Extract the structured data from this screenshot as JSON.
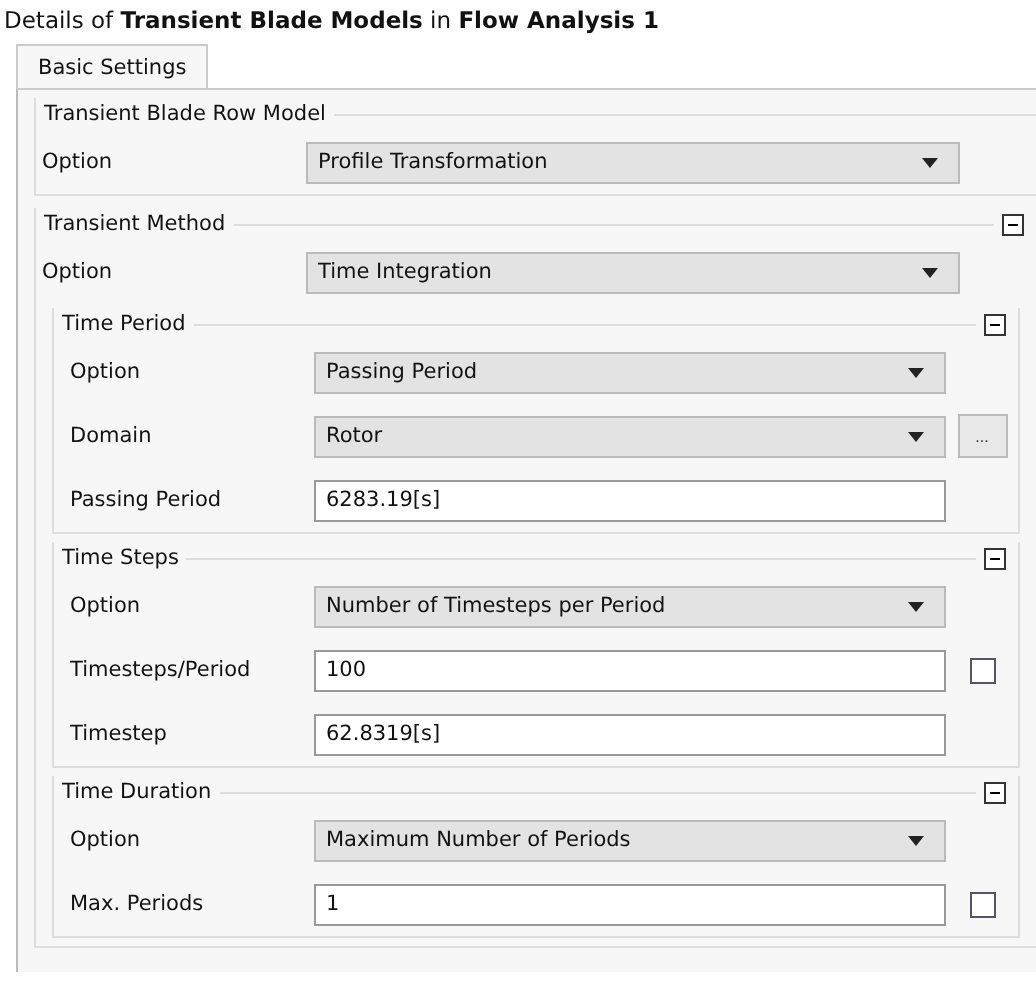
{
  "title": "Details of **Transient Blade Models** in **Flow Analysis 1**",
  "tabs": [
    {
      "label": "Basic Settings",
      "selected": true
    }
  ],
  "groups": [
    {
      "title": "Transient Blade Row Model",
      "rows": [
        {
          "kind": "dropdown",
          "label": "Option",
          "value": "Profile Transformation"
        }
      ]
    },
    {
      "title": "Transient Method",
      "expanded": true,
      "rows": [
        {
          "kind": "dropdown",
          "label": "Option",
          "value": "Time Integration"
        }
      ],
      "subgroups": [
        {
          "title": "Time Period",
          "expanded": true,
          "rows": [
            {
              "kind": "dropdown",
              "label": "Option",
              "value": "Passing Period"
            },
            {
              "kind": "dropdown",
              "label": "Domain",
              "value": "Rotor",
              "button": "..."
            },
            {
              "kind": "input",
              "label": "Passing Period",
              "value": "6283.19[s]"
            }
          ]
        },
        {
          "title": "Time Steps",
          "expanded": true,
          "rows": [
            {
              "kind": "dropdown",
              "label": "Option",
              "value": "Number of Timesteps per Period"
            },
            {
              "kind": "input",
              "label": "Timesteps/Period",
              "value": "100",
              "checked": false
            },
            {
              "kind": "input",
              "label": "Timestep",
              "value": "62.8319[s]"
            }
          ]
        },
        {
          "title": "Time Duration",
          "expanded": true,
          "rows": [
            {
              "kind": "dropdown",
              "label": "Option",
              "value": "Maximum Number of Periods"
            },
            {
              "kind": "input",
              "label": "Max. Periods",
              "value": "1",
              "checked": false
            }
          ]
        }
      ]
    }
  ]
}
